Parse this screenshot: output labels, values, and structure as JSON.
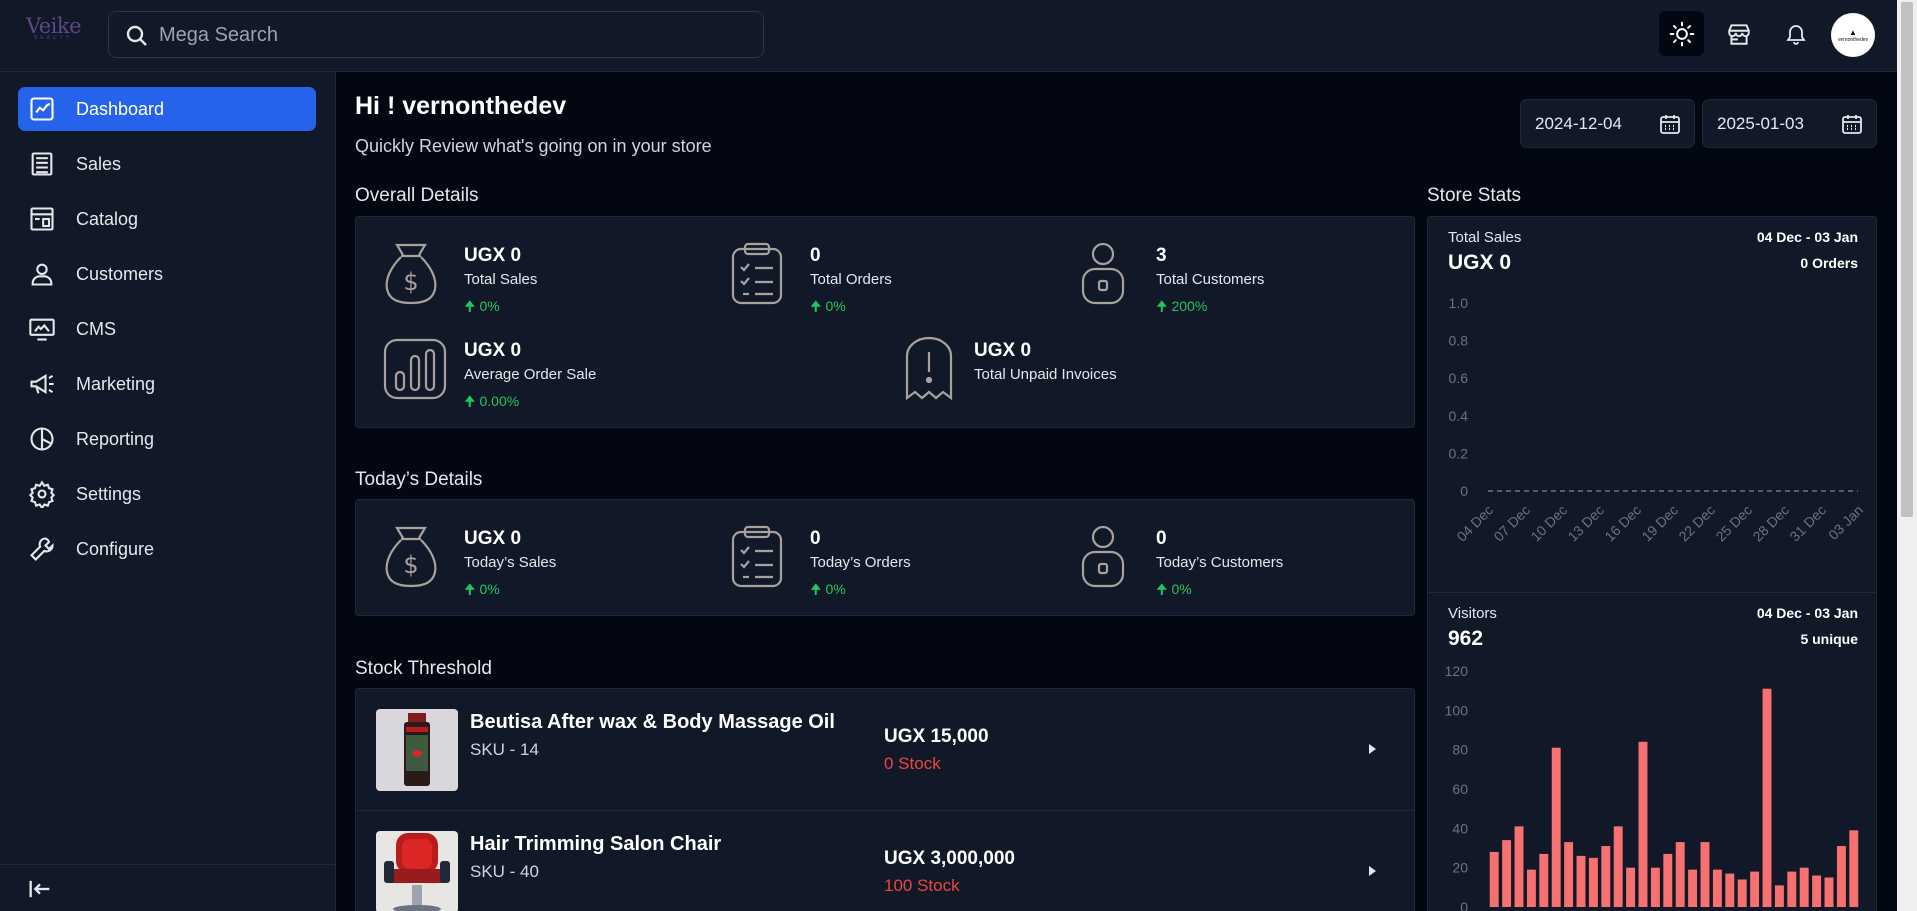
{
  "brand": {
    "name": "Veike",
    "tagline": "BEAUTY"
  },
  "search": {
    "placeholder": "Mega Search"
  },
  "header_icons": [
    "sun-icon",
    "store-icon",
    "bell-icon"
  ],
  "avatar": {
    "text": "vernonthedev"
  },
  "sidebar": {
    "items": [
      {
        "label": "Dashboard",
        "icon": "dashboard-icon",
        "active": true
      },
      {
        "label": "Sales",
        "icon": "sales-icon"
      },
      {
        "label": "Catalog",
        "icon": "catalog-icon"
      },
      {
        "label": "Customers",
        "icon": "customers-icon"
      },
      {
        "label": "CMS",
        "icon": "cms-icon"
      },
      {
        "label": "Marketing",
        "icon": "megaphone-icon"
      },
      {
        "label": "Reporting",
        "icon": "pie-chart-icon"
      },
      {
        "label": "Settings",
        "icon": "gear-icon"
      },
      {
        "label": "Configure",
        "icon": "wrench-icon"
      }
    ]
  },
  "page": {
    "greeting": "Hi ! vernonthedev",
    "subtitle": "Quickly Review what's going on in your store",
    "date_from": "2024-12-04",
    "date_to": "2025-01-03"
  },
  "overall": {
    "title": "Overall Details",
    "total_sales": {
      "value": "UGX 0",
      "label": "Total Sales",
      "change": "0%"
    },
    "total_orders": {
      "value": "0",
      "label": "Total Orders",
      "change": "0%"
    },
    "total_customers": {
      "value": "3",
      "label": "Total Customers",
      "change": "200%"
    },
    "avg_order": {
      "value": "UGX 0",
      "label": "Average Order Sale",
      "change": "0.00%"
    },
    "unpaid": {
      "value": "UGX 0",
      "label": "Total Unpaid Invoices"
    }
  },
  "today": {
    "title": "Today’s Details",
    "sales": {
      "value": "UGX 0",
      "label": "Today’s Sales",
      "change": "0%"
    },
    "orders": {
      "value": "0",
      "label": "Today’s Orders",
      "change": "0%"
    },
    "customers": {
      "value": "0",
      "label": "Today’s Customers",
      "change": "0%"
    }
  },
  "stock": {
    "title": "Stock Threshold",
    "items": [
      {
        "name": "Beutisa After wax & Body Massage Oil",
        "sku": "SKU - 14",
        "price": "UGX 15,000",
        "stock": "0 Stock"
      },
      {
        "name": "Hair Trimming Salon Chair",
        "sku": "SKU - 40",
        "price": "UGX 3,000,000",
        "stock": "100 Stock"
      }
    ]
  },
  "store_stats": {
    "title": "Store Stats",
    "sales_panel": {
      "label": "Total Sales",
      "value": "UGX 0",
      "range": "04 Dec - 03 Jan",
      "orders": "0 Orders"
    },
    "visitors_panel": {
      "label": "Visitors",
      "value": "962",
      "range": "04 Dec - 03 Jan",
      "unique": "5 unique"
    }
  },
  "chart_data": [
    {
      "type": "line",
      "ylim": [
        0,
        1
      ],
      "yticks": [
        "1.0",
        "0.8",
        "0.6",
        "0.4",
        "0.2",
        "0"
      ],
      "categories": [
        "04 Dec",
        "07 Dec",
        "10 Dec",
        "13 Dec",
        "16 Dec",
        "19 Dec",
        "22 Dec",
        "25 Dec",
        "28 Dec",
        "31 Dec",
        "03 Jan"
      ],
      "values": [
        0,
        0,
        0,
        0,
        0,
        0,
        0,
        0,
        0,
        0,
        0
      ],
      "color": "#6b7280"
    },
    {
      "type": "bar",
      "ylim": [
        0,
        120
      ],
      "yticks": [
        "120",
        "100",
        "80",
        "60",
        "40",
        "20",
        "0"
      ],
      "values": [
        28,
        34,
        41,
        19,
        27,
        81,
        33,
        26,
        25,
        31,
        41,
        20,
        84,
        20,
        27,
        33,
        19,
        33,
        19,
        17,
        14,
        18,
        111,
        11,
        18,
        20,
        16,
        15,
        31,
        39
      ],
      "color": "#f87171"
    }
  ]
}
